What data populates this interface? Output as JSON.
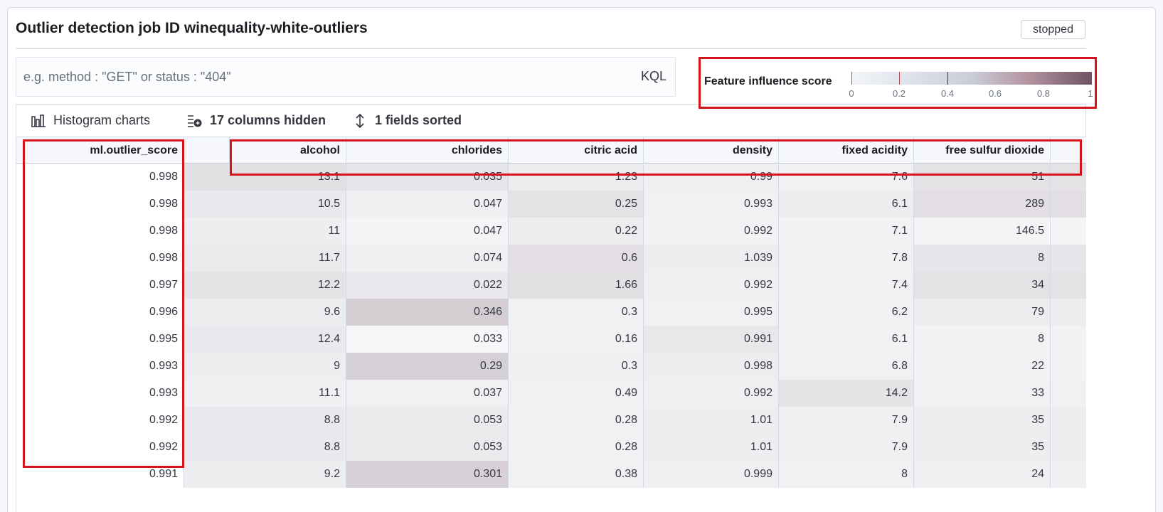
{
  "title": "Outlier detection job ID winequality-white-outliers",
  "status": "stopped",
  "search": {
    "placeholder": "e.g. method : \"GET\" or status : \"404\"",
    "language": "KQL"
  },
  "legend": {
    "title": "Feature influence score",
    "ticks": [
      "0",
      "0.2",
      "0.4",
      "0.6",
      "0.8",
      "1"
    ]
  },
  "toolbar": {
    "histogram_label": "Histogram charts",
    "hidden_label": "17 columns hidden",
    "sorted_label": "1 fields sorted"
  },
  "columns": [
    "ml.outlier_score",
    "",
    "alcohol",
    "chlorides",
    "citric acid",
    "density",
    "fixed acidity",
    "free sulfur dioxide",
    ""
  ],
  "rows": [
    [
      "0.998",
      "13.1",
      "0.035",
      "1.23",
      "0.99",
      "7.6",
      "51"
    ],
    [
      "0.998",
      "10.5",
      "0.047",
      "0.25",
      "0.993",
      "6.1",
      "289"
    ],
    [
      "0.998",
      "11",
      "0.047",
      "0.22",
      "0.992",
      "7.1",
      "146.5"
    ],
    [
      "0.998",
      "11.7",
      "0.074",
      "0.6",
      "1.039",
      "7.8",
      "8"
    ],
    [
      "0.997",
      "12.2",
      "0.022",
      "1.66",
      "0.992",
      "7.4",
      "34"
    ],
    [
      "0.996",
      "9.6",
      "0.346",
      "0.3",
      "0.995",
      "6.2",
      "79"
    ],
    [
      "0.995",
      "12.4",
      "0.033",
      "0.16",
      "0.991",
      "6.1",
      "8"
    ],
    [
      "0.993",
      "9",
      "0.29",
      "0.3",
      "0.998",
      "6.8",
      "22"
    ],
    [
      "0.993",
      "11.1",
      "0.037",
      "0.49",
      "0.992",
      "14.2",
      "33"
    ],
    [
      "0.992",
      "8.8",
      "0.053",
      "0.28",
      "1.01",
      "7.9",
      "35"
    ],
    [
      "0.992",
      "8.8",
      "0.053",
      "0.28",
      "1.01",
      "7.9",
      "35"
    ],
    [
      "0.991",
      "9.2",
      "0.301",
      "0.38",
      "0.999",
      "8",
      "24"
    ]
  ],
  "influence": [
    [
      0.15,
      0.15,
      0.12,
      0.08,
      0.06,
      0.04,
      0.14
    ],
    [
      0.15,
      0.1,
      0.06,
      0.14,
      0.05,
      0.08,
      0.16
    ],
    [
      0.1,
      0.07,
      0.03,
      0.08,
      0.04,
      0.04,
      0.03
    ],
    [
      0.14,
      0.09,
      0.06,
      0.16,
      0.07,
      0.05,
      0.12
    ],
    [
      0.13,
      0.13,
      0.1,
      0.15,
      0.06,
      0.05,
      0.14
    ],
    [
      0.11,
      0.08,
      0.26,
      0.05,
      0.05,
      0.05,
      0.08
    ],
    [
      0.12,
      0.1,
      0.02,
      0.05,
      0.11,
      0.04,
      0.04
    ],
    [
      0.1,
      0.07,
      0.25,
      0.06,
      0.07,
      0.05,
      0.04
    ],
    [
      0.08,
      0.06,
      0.05,
      0.05,
      0.06,
      0.13,
      0.05
    ],
    [
      0.11,
      0.1,
      0.09,
      0.05,
      0.07,
      0.06,
      0.07
    ],
    [
      0.11,
      0.1,
      0.09,
      0.05,
      0.07,
      0.06,
      0.07
    ],
    [
      0.1,
      0.08,
      0.24,
      0.05,
      0.06,
      0.05,
      0.06
    ]
  ],
  "colors": {
    "accent": "#d4131b",
    "influence_low": "#f8f9fb",
    "influence_high": "#6d5363"
  }
}
